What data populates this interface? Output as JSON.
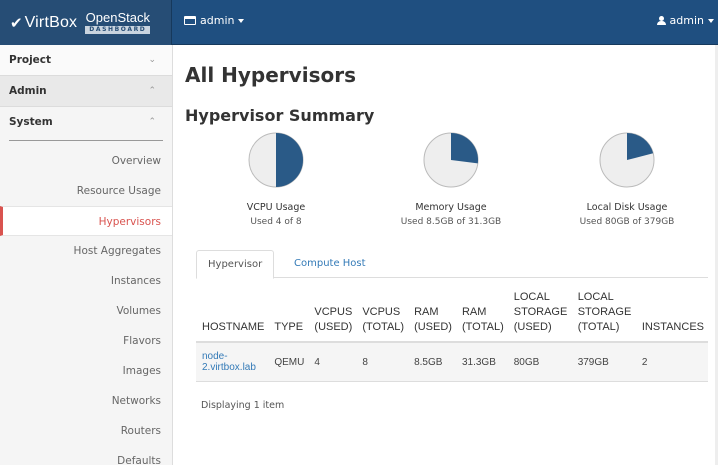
{
  "topbar": {
    "brand_main": "VirtBox",
    "brand_openstack": "OpenStack",
    "brand_dashboard": "DASHBOARD",
    "project_menu": "admin",
    "user_menu": "admin"
  },
  "sidebar": {
    "sections": [
      {
        "label": "Project",
        "chevron": "v"
      },
      {
        "label": "Admin",
        "chevron": "^"
      },
      {
        "label": "System",
        "chevron": "^"
      }
    ],
    "items": [
      {
        "label": "Overview"
      },
      {
        "label": "Resource Usage"
      },
      {
        "label": "Hypervisors",
        "active": true
      },
      {
        "label": "Host Aggregates"
      },
      {
        "label": "Instances"
      },
      {
        "label": "Volumes"
      },
      {
        "label": "Flavors"
      },
      {
        "label": "Images"
      },
      {
        "label": "Networks"
      },
      {
        "label": "Routers"
      },
      {
        "label": "Defaults"
      }
    ]
  },
  "main": {
    "title": "All Hypervisors",
    "summary_title": "Hypervisor Summary",
    "colors": {
      "pie_used": "#2a5a87",
      "pie_free": "#eeeeee",
      "pie_stroke": "#bbbbbb"
    },
    "usage": [
      {
        "label": "VCPU Usage",
        "detail": "Used 4 of 8",
        "fraction": 0.5
      },
      {
        "label": "Memory Usage",
        "detail": "Used 8.5GB of 31.3GB",
        "fraction": 0.27
      },
      {
        "label": "Local Disk Usage",
        "detail": "Used 80GB of 379GB",
        "fraction": 0.21
      }
    ],
    "tabs": [
      {
        "label": "Hypervisor",
        "active": true
      },
      {
        "label": "Compute Host",
        "active": false
      }
    ],
    "table": {
      "headers": {
        "hostname": "HOSTNAME",
        "type": "TYPE",
        "vcpus_used_1": "VCPUS",
        "vcpus_used_2": "(USED)",
        "vcpus_total_1": "VCPUS",
        "vcpus_total_2": "(TOTAL)",
        "ram_used_1": "RAM",
        "ram_used_2": "(USED)",
        "ram_total_1": "RAM",
        "ram_total_2": "(TOTAL)",
        "ls_used_1": "LOCAL",
        "ls_used_2": "STORAGE",
        "ls_used_3": "(USED)",
        "ls_total_1": "LOCAL",
        "ls_total_2": "STORAGE",
        "ls_total_3": "(TOTAL)",
        "instances": "INSTANCES"
      },
      "rows": [
        {
          "hostname_1": "node-",
          "hostname_2": "2.virtbox.lab",
          "type": "QEMU",
          "vcpus_used": "4",
          "vcpus_total": "8",
          "ram_used": "8.5GB",
          "ram_total": "31.3GB",
          "ls_used": "80GB",
          "ls_total": "379GB",
          "instances": "2"
        }
      ]
    },
    "footer": "Displaying 1 item"
  }
}
